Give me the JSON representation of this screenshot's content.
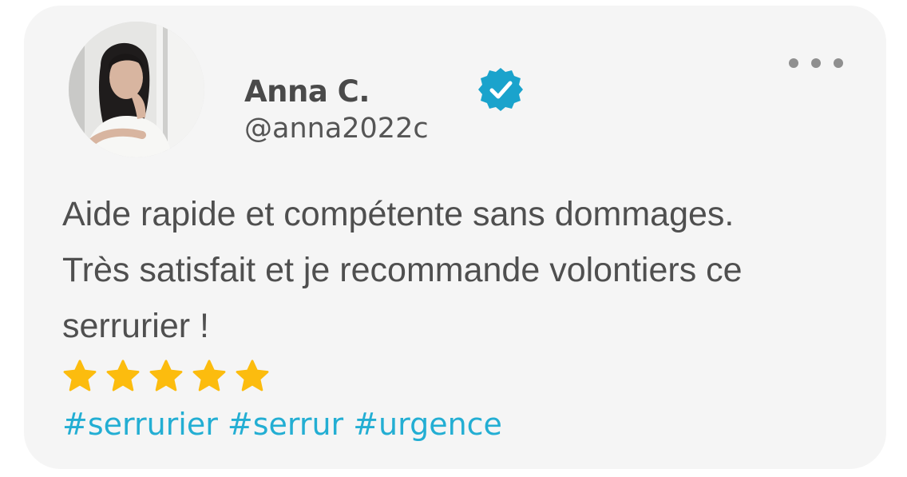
{
  "review": {
    "author_name": "Anna C.",
    "author_handle": "@anna2022c",
    "verified": true,
    "text": "Aide rapide et compétente sans dommages. Très satisfait et je recommande volontiers ce serrurier !",
    "rating": 5,
    "rating_max": 5,
    "hashtags": [
      "#serrurier",
      "#serrur",
      "#urgence"
    ]
  },
  "icons": {
    "verified": "verified-badge-icon",
    "more": "more-options-icon",
    "star": "star-icon"
  },
  "colors": {
    "card_background": "#f5f5f5",
    "verified_badge": "#1aa3cc",
    "star": "#fcbc0e",
    "hashtag": "#23aed3",
    "name_text": "#4a4a4a",
    "body_text": "#4f4f4f"
  }
}
